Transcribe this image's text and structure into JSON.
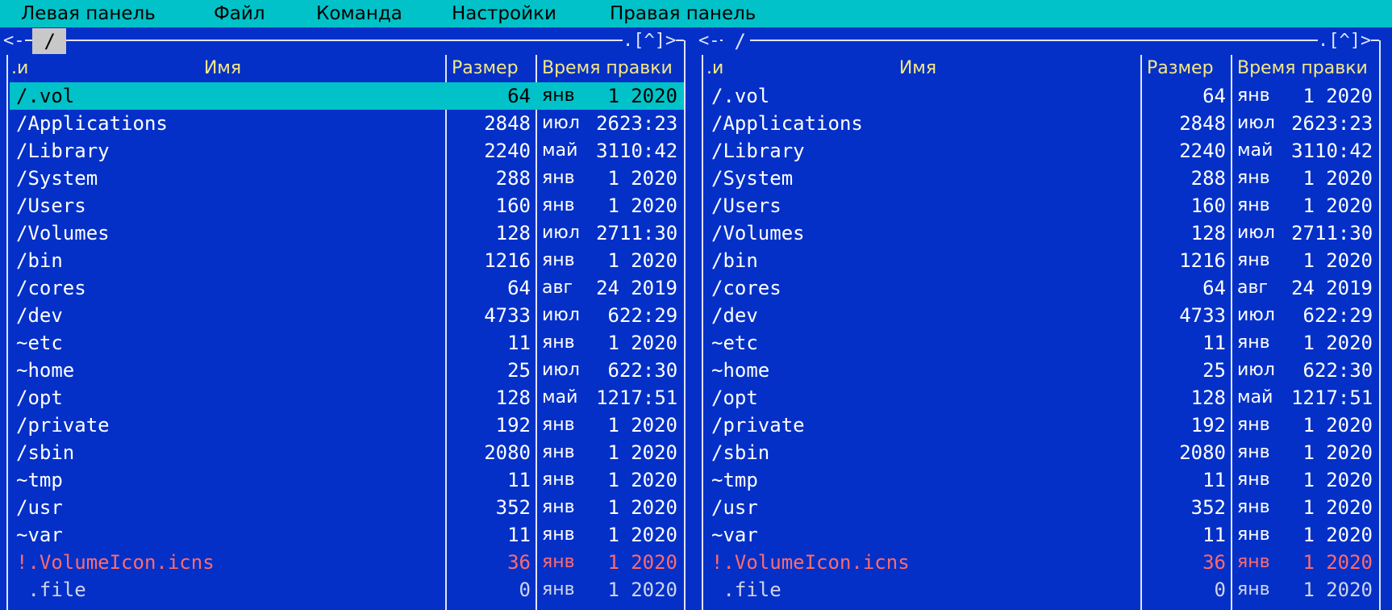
{
  "menu": {
    "items": [
      "Левая панель",
      "Файл",
      "Команда",
      "Настройки",
      "Правая панель"
    ]
  },
  "frame": {
    "left_corner": "<-",
    "right_corner": ".[^]>"
  },
  "panels": [
    {
      "path": " / ",
      "active": true,
      "headers": {
        "sort": ".и",
        "name": "Имя",
        "size": "Размер",
        "mtime": "Время правки"
      },
      "rows": [
        {
          "name": "/.vol",
          "size": "64",
          "mon": "янв",
          "day": "1",
          "time": "2020",
          "style": "sel"
        },
        {
          "name": "/Applications",
          "size": "2848",
          "mon": "июл",
          "day": "26",
          "time": "23:23",
          "style": ""
        },
        {
          "name": "/Library",
          "size": "2240",
          "mon": "май",
          "day": "31",
          "time": "10:42",
          "style": ""
        },
        {
          "name": "/System",
          "size": "288",
          "mon": "янв",
          "day": "1",
          "time": "2020",
          "style": ""
        },
        {
          "name": "/Users",
          "size": "160",
          "mon": "янв",
          "day": "1",
          "time": "2020",
          "style": ""
        },
        {
          "name": "/Volumes",
          "size": "128",
          "mon": "июл",
          "day": "27",
          "time": "11:30",
          "style": ""
        },
        {
          "name": "/bin",
          "size": "1216",
          "mon": "янв",
          "day": "1",
          "time": "2020",
          "style": ""
        },
        {
          "name": "/cores",
          "size": "64",
          "mon": "авг",
          "day": "24",
          "time": "2019",
          "style": ""
        },
        {
          "name": "/dev",
          "size": "4733",
          "mon": "июл",
          "day": "6",
          "time": "22:29",
          "style": ""
        },
        {
          "name": "~etc",
          "size": "11",
          "mon": "янв",
          "day": "1",
          "time": "2020",
          "style": ""
        },
        {
          "name": "~home",
          "size": "25",
          "mon": "июл",
          "day": "6",
          "time": "22:30",
          "style": ""
        },
        {
          "name": "/opt",
          "size": "128",
          "mon": "май",
          "day": "12",
          "time": "17:51",
          "style": ""
        },
        {
          "name": "/private",
          "size": "192",
          "mon": "янв",
          "day": "1",
          "time": "2020",
          "style": ""
        },
        {
          "name": "/sbin",
          "size": "2080",
          "mon": "янв",
          "day": "1",
          "time": "2020",
          "style": ""
        },
        {
          "name": "~tmp",
          "size": "11",
          "mon": "янв",
          "day": "1",
          "time": "2020",
          "style": ""
        },
        {
          "name": "/usr",
          "size": "352",
          "mon": "янв",
          "day": "1",
          "time": "2020",
          "style": ""
        },
        {
          "name": "~var",
          "size": "11",
          "mon": "янв",
          "day": "1",
          "time": "2020",
          "style": ""
        },
        {
          "name": "!.VolumeIcon.icns",
          "size": "36",
          "mon": "янв",
          "day": "1",
          "time": "2020",
          "style": "warn"
        },
        {
          "name": " .file",
          "size": "0",
          "mon": "янв",
          "day": "1",
          "time": "2020",
          "style": "dim"
        }
      ]
    },
    {
      "path": " / ",
      "active": false,
      "headers": {
        "sort": ".и",
        "name": "Имя",
        "size": "Размер",
        "mtime": "Время правки"
      },
      "rows": [
        {
          "name": "/.vol",
          "size": "64",
          "mon": "янв",
          "day": "1",
          "time": "2020",
          "style": ""
        },
        {
          "name": "/Applications",
          "size": "2848",
          "mon": "июл",
          "day": "26",
          "time": "23:23",
          "style": ""
        },
        {
          "name": "/Library",
          "size": "2240",
          "mon": "май",
          "day": "31",
          "time": "10:42",
          "style": ""
        },
        {
          "name": "/System",
          "size": "288",
          "mon": "янв",
          "day": "1",
          "time": "2020",
          "style": ""
        },
        {
          "name": "/Users",
          "size": "160",
          "mon": "янв",
          "day": "1",
          "time": "2020",
          "style": ""
        },
        {
          "name": "/Volumes",
          "size": "128",
          "mon": "июл",
          "day": "27",
          "time": "11:30",
          "style": ""
        },
        {
          "name": "/bin",
          "size": "1216",
          "mon": "янв",
          "day": "1",
          "time": "2020",
          "style": ""
        },
        {
          "name": "/cores",
          "size": "64",
          "mon": "авг",
          "day": "24",
          "time": "2019",
          "style": ""
        },
        {
          "name": "/dev",
          "size": "4733",
          "mon": "июл",
          "day": "6",
          "time": "22:29",
          "style": ""
        },
        {
          "name": "~etc",
          "size": "11",
          "mon": "янв",
          "day": "1",
          "time": "2020",
          "style": ""
        },
        {
          "name": "~home",
          "size": "25",
          "mon": "июл",
          "day": "6",
          "time": "22:30",
          "style": ""
        },
        {
          "name": "/opt",
          "size": "128",
          "mon": "май",
          "day": "12",
          "time": "17:51",
          "style": ""
        },
        {
          "name": "/private",
          "size": "192",
          "mon": "янв",
          "day": "1",
          "time": "2020",
          "style": ""
        },
        {
          "name": "/sbin",
          "size": "2080",
          "mon": "янв",
          "day": "1",
          "time": "2020",
          "style": ""
        },
        {
          "name": "~tmp",
          "size": "11",
          "mon": "янв",
          "day": "1",
          "time": "2020",
          "style": ""
        },
        {
          "name": "/usr",
          "size": "352",
          "mon": "янв",
          "day": "1",
          "time": "2020",
          "style": ""
        },
        {
          "name": "~var",
          "size": "11",
          "mon": "янв",
          "day": "1",
          "time": "2020",
          "style": ""
        },
        {
          "name": "!.VolumeIcon.icns",
          "size": "36",
          "mon": "янв",
          "day": "1",
          "time": "2020",
          "style": "warn"
        },
        {
          "name": " .file",
          "size": "0",
          "mon": "янв",
          "day": "1",
          "time": "2020",
          "style": "dim"
        }
      ]
    }
  ],
  "colors": {
    "background": "#0430c8",
    "menubar": "#00c2c8",
    "header_text": "#f5e884",
    "selection": "#00c2c8",
    "warning": "#ff6b6b"
  }
}
